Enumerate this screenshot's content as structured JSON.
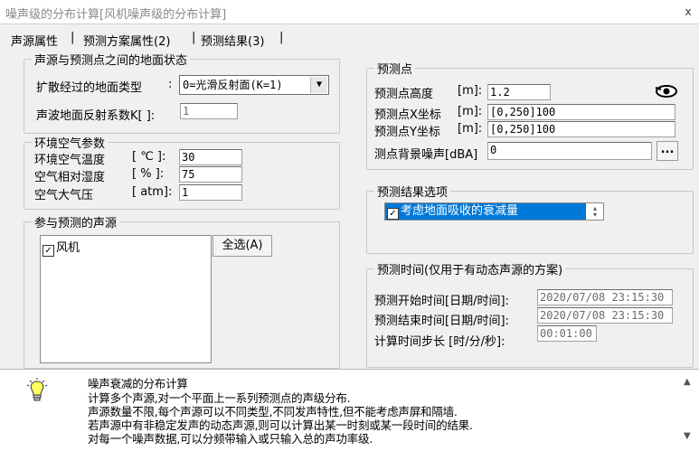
{
  "window": {
    "title": "噪声级的分布计算[风机噪声级的分布计算]",
    "close_label": "x"
  },
  "tabs": [
    {
      "label": "声源属性"
    },
    {
      "label": "预测方案属性(2)"
    },
    {
      "label": "预测结果(3)"
    }
  ],
  "ground": {
    "legend": "声源与预测点之间的地面状态",
    "type_label": "扩散经过的地面类型",
    "type_colon": ":",
    "type_value": "0=光滑反射面(K=1)",
    "coef_label": "声波地面反射系数K[ ]:",
    "coef_value": "1"
  },
  "env": {
    "legend": "环境空气参数",
    "temp_label": "环境空气温度",
    "temp_unit": "[ ℃ ]:",
    "temp_value": "30",
    "humidity_label": "空气相对湿度",
    "humidity_unit": "[  % ]:",
    "humidity_value": "75",
    "pressure_label": "空气大气压",
    "pressure_unit": "[ atm]:",
    "pressure_value": "1"
  },
  "sources": {
    "legend": "参与预测的声源",
    "items": [
      {
        "label": "风机",
        "checked": true
      }
    ],
    "select_all_label": "全选(A)"
  },
  "point": {
    "legend": "预测点",
    "height_label": "预测点高度",
    "height_unit": "[m]:",
    "height_value": "1.2",
    "x_label": "预测点X坐标",
    "x_unit": "[m]:",
    "x_value": "[0,250]100",
    "y_label": "预测点Y坐标",
    "y_unit": "[m]:",
    "y_value": "[0,250]100",
    "bg_label": "测点背景噪声[dBA]",
    "bg_value": "0",
    "browse_label": "..."
  },
  "options": {
    "legend": "预测结果选项",
    "items": [
      {
        "label": "考虑地面吸收的衰减量",
        "checked": true
      }
    ]
  },
  "time": {
    "legend": "预测时间(仅用于有动态声源的方案)",
    "start_label": "预测开始时间[日期/时间]:",
    "start_value": "2020/07/08 23:15:30",
    "end_label": "预测结束时间[日期/时间]:",
    "end_value": "2020/07/08 23:15:30",
    "step_label": "计算时间步长 [时/分/秒]:",
    "step_value": "00:01:00"
  },
  "info": {
    "title": "噪声衰减的分布计算",
    "lines": [
      "计算多个声源,对一个平面上一系列预测点的声级分布.",
      "声源数量不限,每个声源可以不同类型,不同发声特性,但不能考虑声屏和隔墙.",
      "若声源中有非稳定发声的动态声源,则可以计算出某一时刻或某一段时间的结果.",
      "对每一个噪声数据,可以分频带输入或只输入总的声功率级."
    ]
  }
}
